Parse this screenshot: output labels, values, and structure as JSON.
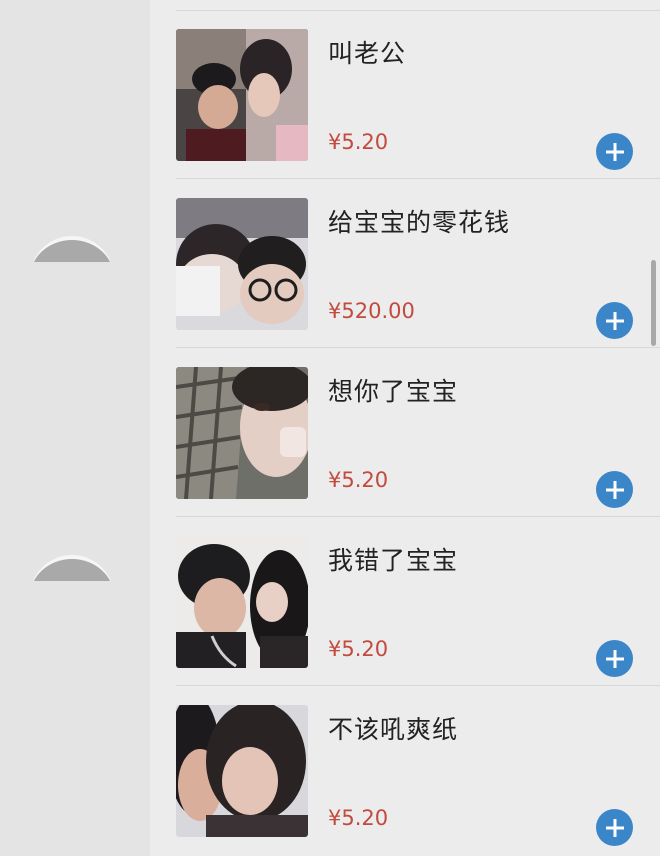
{
  "products": [
    {
      "title": "叫老公",
      "price": "¥5.20"
    },
    {
      "title": "给宝宝的零花钱",
      "price": "¥520.00"
    },
    {
      "title": "想你了宝宝",
      "price": "¥5.20"
    },
    {
      "title": "我错了宝宝",
      "price": "¥5.20"
    },
    {
      "title": "不该吼爽纸",
      "price": "¥5.20"
    }
  ],
  "icons": {
    "add": "plus-circle-icon"
  },
  "colors": {
    "price": "#c24a3e",
    "add_button": "#3b86c9",
    "background": "#ececec"
  }
}
